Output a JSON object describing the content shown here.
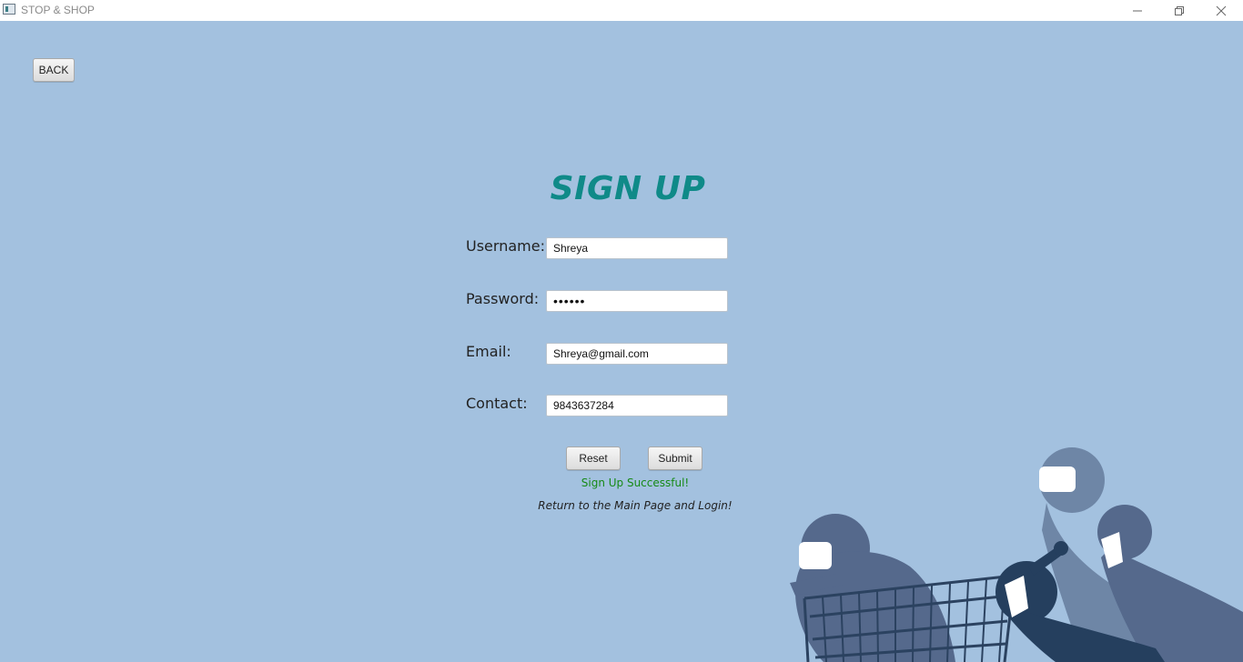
{
  "window": {
    "title": "STOP & SHOP",
    "controls": [
      "minimize",
      "restore",
      "close"
    ]
  },
  "back_button": {
    "label": "BACK"
  },
  "form": {
    "heading": "SIGN UP",
    "fields": [
      {
        "label": "Username:",
        "value": "Shreya"
      },
      {
        "label": "Password:",
        "value": "••••••"
      },
      {
        "label": "Email:",
        "value": "Shreya@gmail.com"
      },
      {
        "label": "Contact:",
        "value": "9843637284"
      }
    ],
    "reset_label": "Reset",
    "submit_label": "Submit",
    "success_message": "Sign Up Successful!",
    "info_message": "Return to the Main Page and Login!"
  },
  "colors": {
    "background": "#a3c1df",
    "heading": "#0f8a88",
    "success": "#168a16"
  }
}
